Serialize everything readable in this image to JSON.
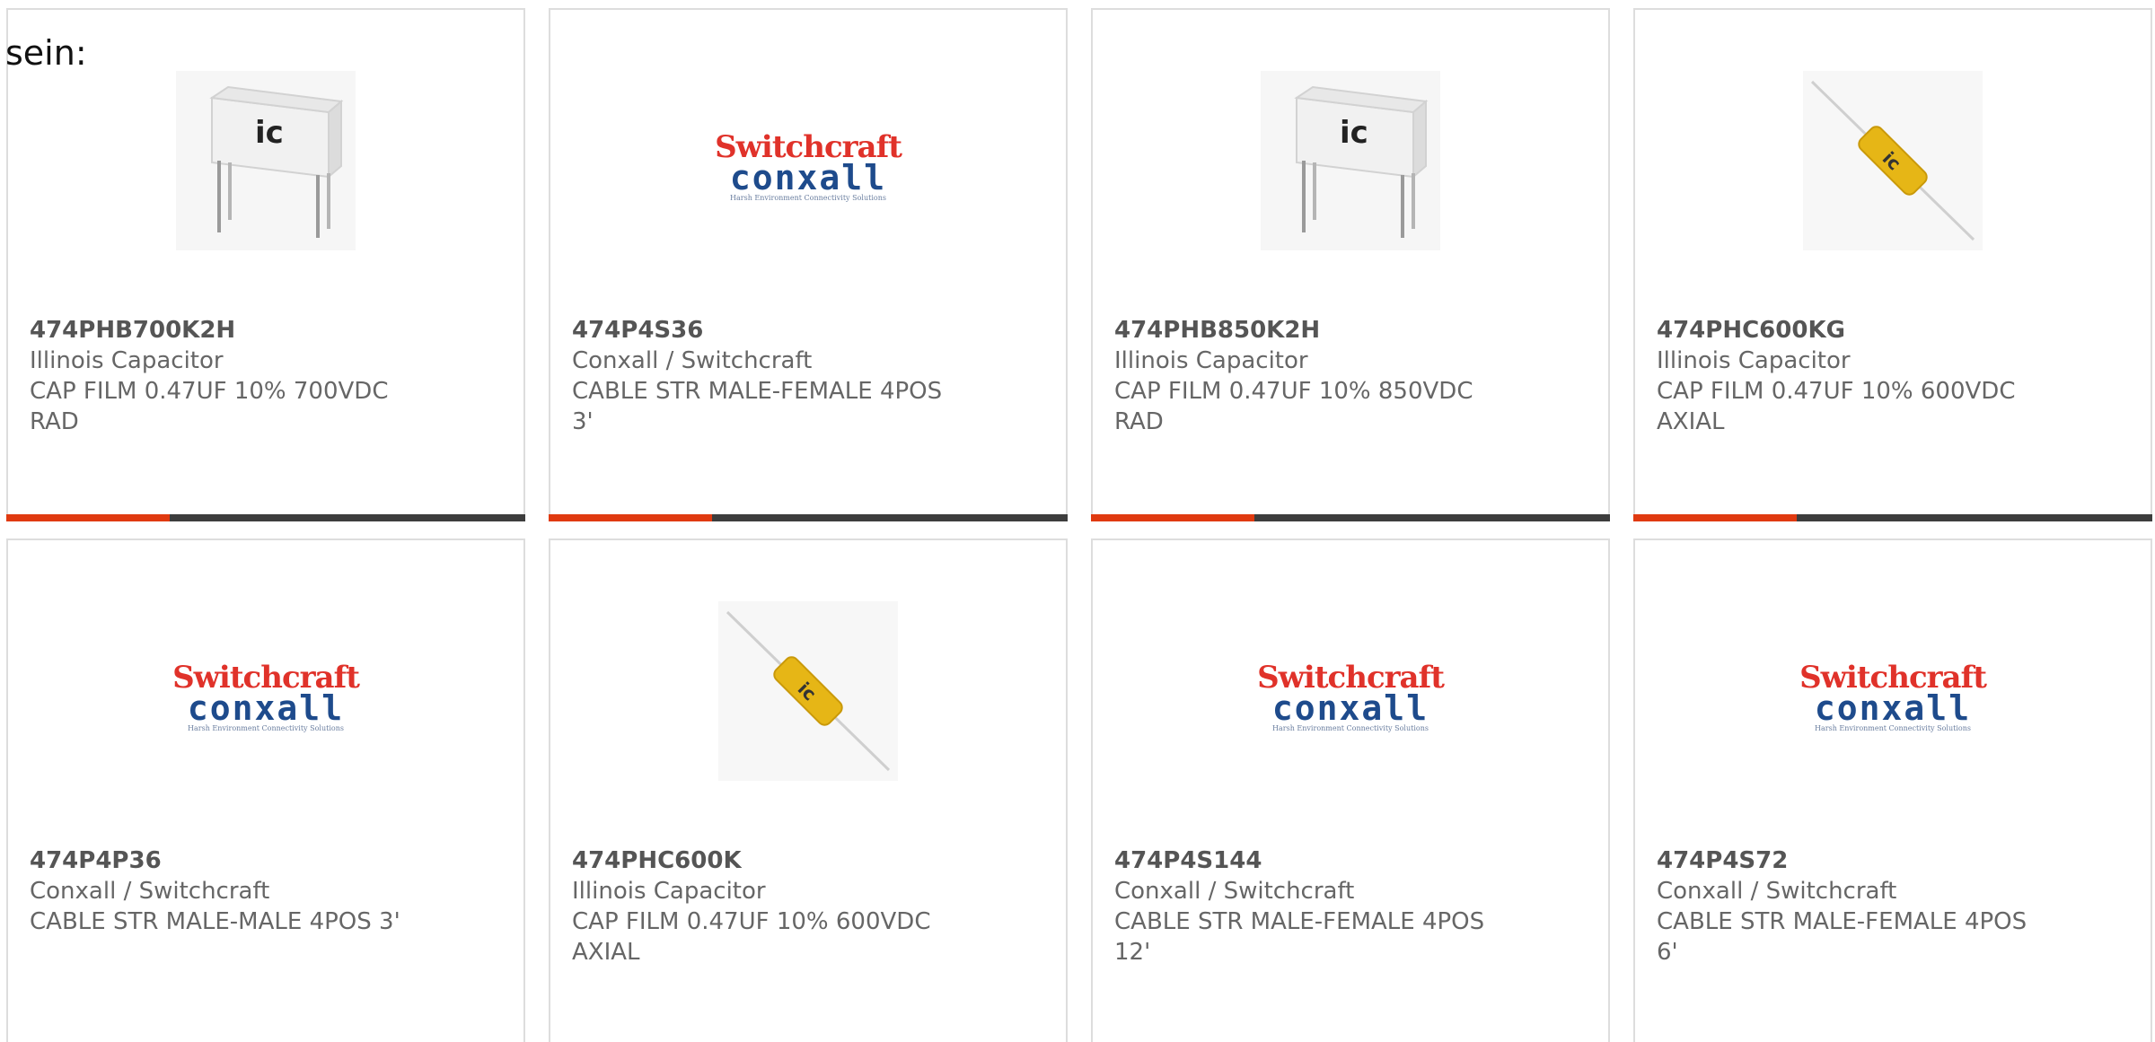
{
  "leading_text": "sein:",
  "logo": {
    "top": "Switchcraft",
    "bottom": "conxall",
    "tagline": "Harsh Environment Connectivity Solutions"
  },
  "colors": {
    "accent": "#e03a10",
    "bar": "#3d3d3d",
    "border": "#dddddd",
    "text": "#666666"
  },
  "products": [
    {
      "part_number": "474PHB700K2H",
      "manufacturer": "Illinois Capacitor",
      "desc1": "CAP FILM 0.47UF 10% 700VDC",
      "desc2": "RAD",
      "image": "radial-film-capacitor-image"
    },
    {
      "part_number": "474P4S36",
      "manufacturer": "Conxall / Switchcraft",
      "desc1": "CABLE STR MALE-FEMALE 4POS",
      "desc2": "3'",
      "image": "switchcraft-conxall-logo"
    },
    {
      "part_number": "474PHB850K2H",
      "manufacturer": "Illinois Capacitor",
      "desc1": "CAP FILM 0.47UF 10% 850VDC",
      "desc2": "RAD",
      "image": "radial-film-capacitor-image"
    },
    {
      "part_number": "474PHC600KG",
      "manufacturer": "Illinois Capacitor",
      "desc1": "CAP FILM 0.47UF 10% 600VDC",
      "desc2": "AXIAL",
      "image": "axial-film-capacitor-image"
    },
    {
      "part_number": "474P4P36",
      "manufacturer": "Conxall / Switchcraft",
      "desc1": "CABLE STR MALE-MALE 4POS 3'",
      "desc2": "",
      "image": "switchcraft-conxall-logo"
    },
    {
      "part_number": "474PHC600K",
      "manufacturer": "Illinois Capacitor",
      "desc1": "CAP FILM 0.47UF 10% 600VDC",
      "desc2": "AXIAL",
      "image": "axial-film-capacitor-image"
    },
    {
      "part_number": "474P4S144",
      "manufacturer": "Conxall / Switchcraft",
      "desc1": "CABLE STR MALE-FEMALE 4POS",
      "desc2": "12'",
      "image": "switchcraft-conxall-logo"
    },
    {
      "part_number": "474P4S72",
      "manufacturer": "Conxall / Switchcraft",
      "desc1": "CABLE STR MALE-FEMALE 4POS",
      "desc2": "6'",
      "image": "switchcraft-conxall-logo"
    }
  ]
}
